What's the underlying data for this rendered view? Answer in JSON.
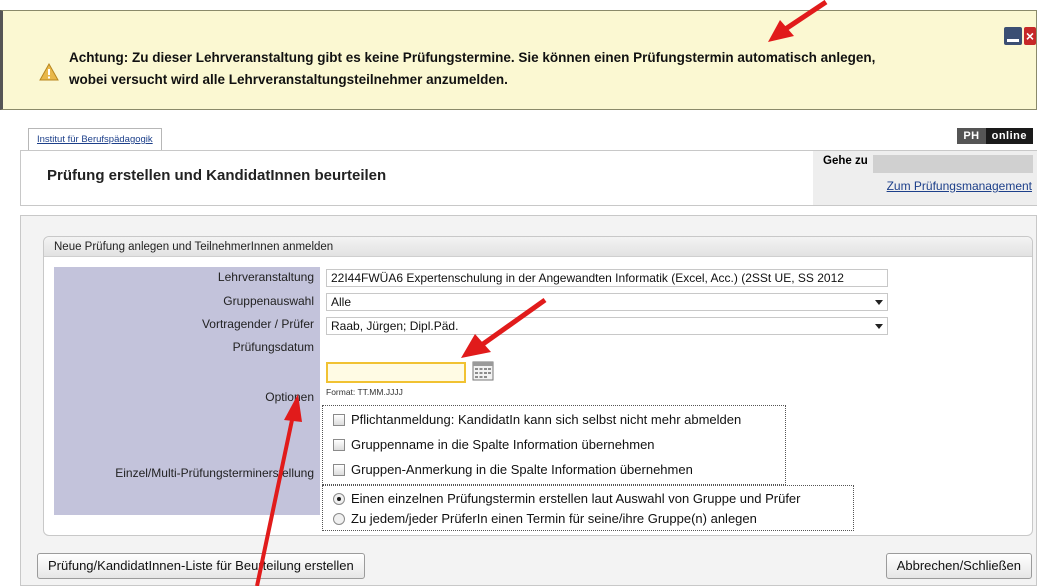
{
  "banner": {
    "message_line1": "Achtung: Zu dieser Lehrveranstaltung gibt es keine Prüfungstermine. Sie können einen Prüfungstermin automatisch anlegen,",
    "message_line2": "wobei versucht wird alle Lehrveranstaltungsteilnehmer anzumelden."
  },
  "tab": {
    "label": "Institut für Berufspädagogik"
  },
  "logo": {
    "ph": "PH",
    "online": "online"
  },
  "header": {
    "title": "Prüfung erstellen und KandidatInnen beurteilen",
    "goto_label": "Gehe zu",
    "goto_link": "Zum Prüfungsmanagement"
  },
  "form": {
    "legend": "Neue Prüfung anlegen und TeilnehmerInnen anmelden",
    "labels": {
      "course": "Lehrveranstaltung",
      "group": "Gruppenauswahl",
      "examiner": "Vortragender / Prüfer",
      "date": "Prüfungsdatum",
      "options": "Optionen",
      "multi": "Einzel/Multi-Prüfungsterminerstellung"
    },
    "course_value": "22I44FWÜA6 Expertenschulung in der Angewandten Informatik (Excel, Acc.) (2SSt UE, SS 2012",
    "group_value": "Alle",
    "examiner_value": "Raab, Jürgen; Dipl.Päd.",
    "date_value": "",
    "date_format": "Format: TT.MM.JJJJ",
    "options": [
      "Pflichtanmeldung: KandidatIn kann sich selbst nicht mehr abmelden",
      "Gruppenname in die Spalte Information übernehmen",
      "Gruppen-Anmerkung in die Spalte Information übernehmen"
    ],
    "radios": [
      "Einen einzelnen Prüfungstermin erstellen laut Auswahl von Gruppe und Prüfer",
      "Zu jedem/jeder PrüferIn einen Termin für seine/ihre Gruppe(n) anlegen"
    ]
  },
  "buttons": {
    "create": "Prüfung/KandidatInnen-Liste für Beurteilung erstellen",
    "cancel": "Abbrechen/Schließen"
  },
  "colors": {
    "banner_bg": "#fbf8d2",
    "label_col": "#c3c3db",
    "arrow": "#e11b1b"
  }
}
